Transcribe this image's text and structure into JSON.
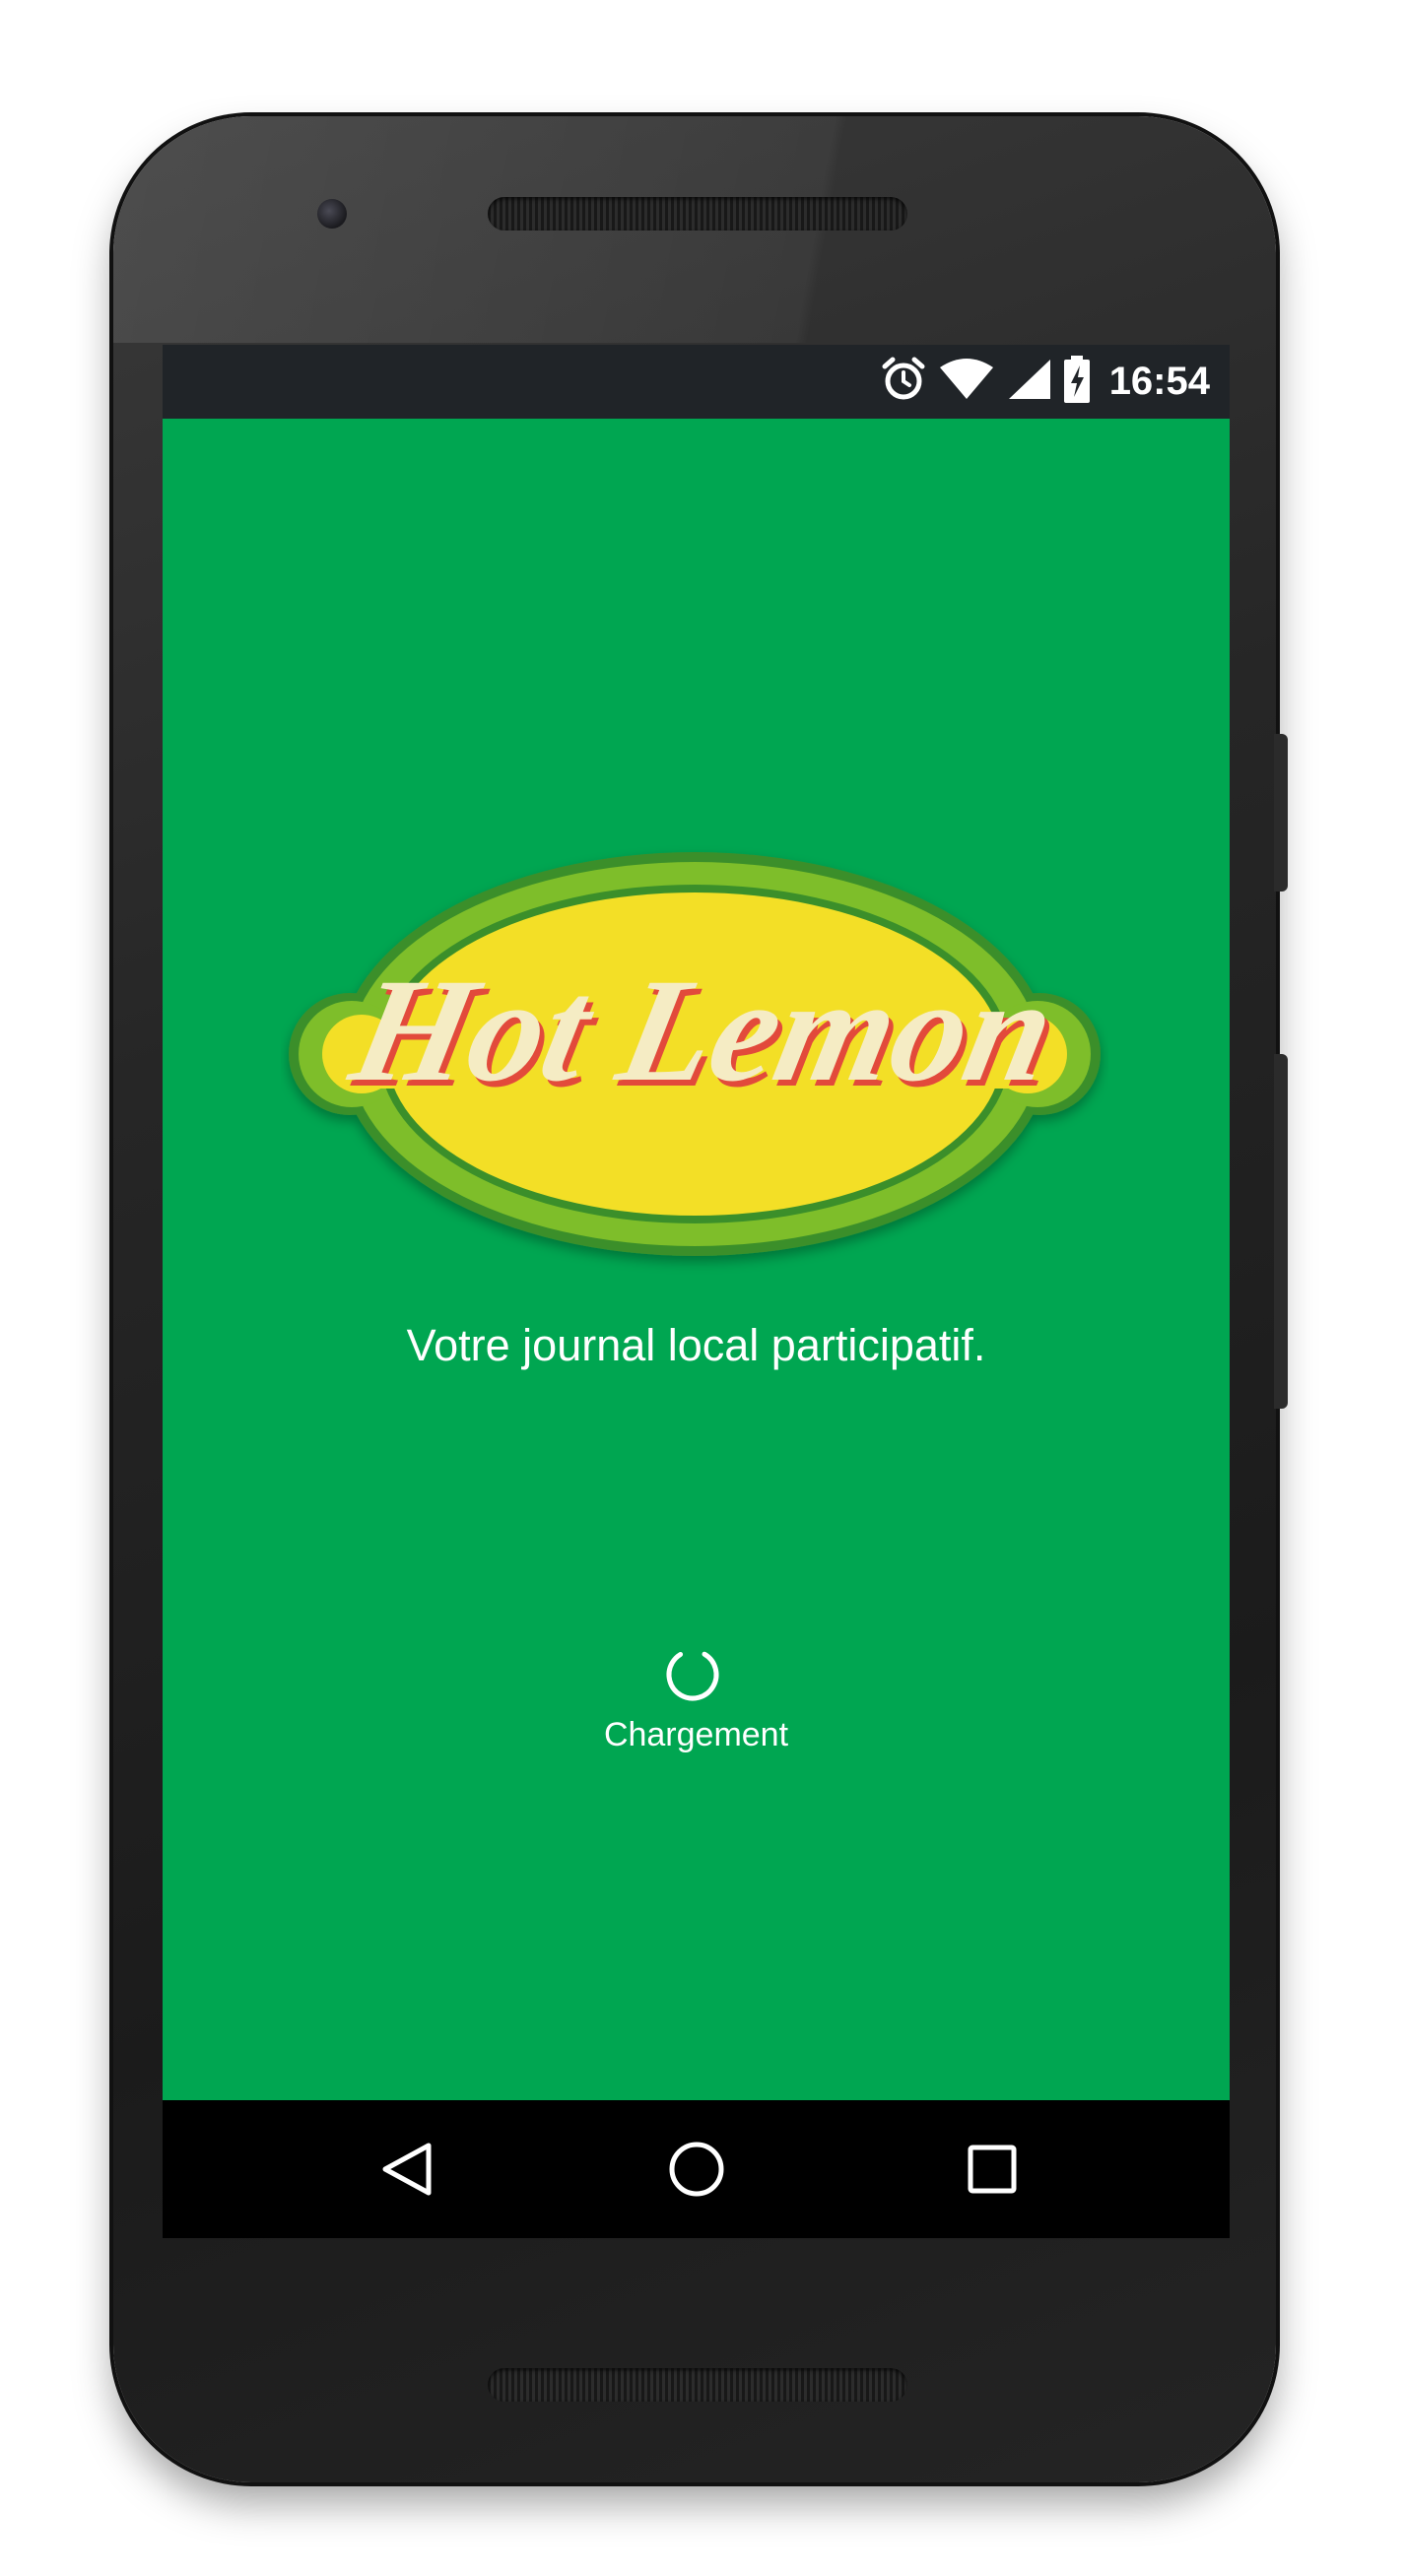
{
  "status_bar": {
    "time": "16:54",
    "icons": [
      "alarm-icon",
      "wifi-icon",
      "signal-icon",
      "battery-charging-icon"
    ]
  },
  "splash": {
    "logo_text": "Hot Lemon",
    "tagline": "Votre journal local participatif.",
    "loading_label": "Chargement"
  },
  "navigation": {
    "buttons": [
      "back-icon",
      "home-icon",
      "recents-icon"
    ]
  },
  "colors": {
    "background": "#00a651",
    "status_bar": "#202428",
    "nav_bar": "#000000",
    "logo_yellow": "#f3df25",
    "logo_ring": "#7ebe29",
    "logo_text": "#f5ecc4",
    "logo_text_shadow": "#e24a3b"
  }
}
